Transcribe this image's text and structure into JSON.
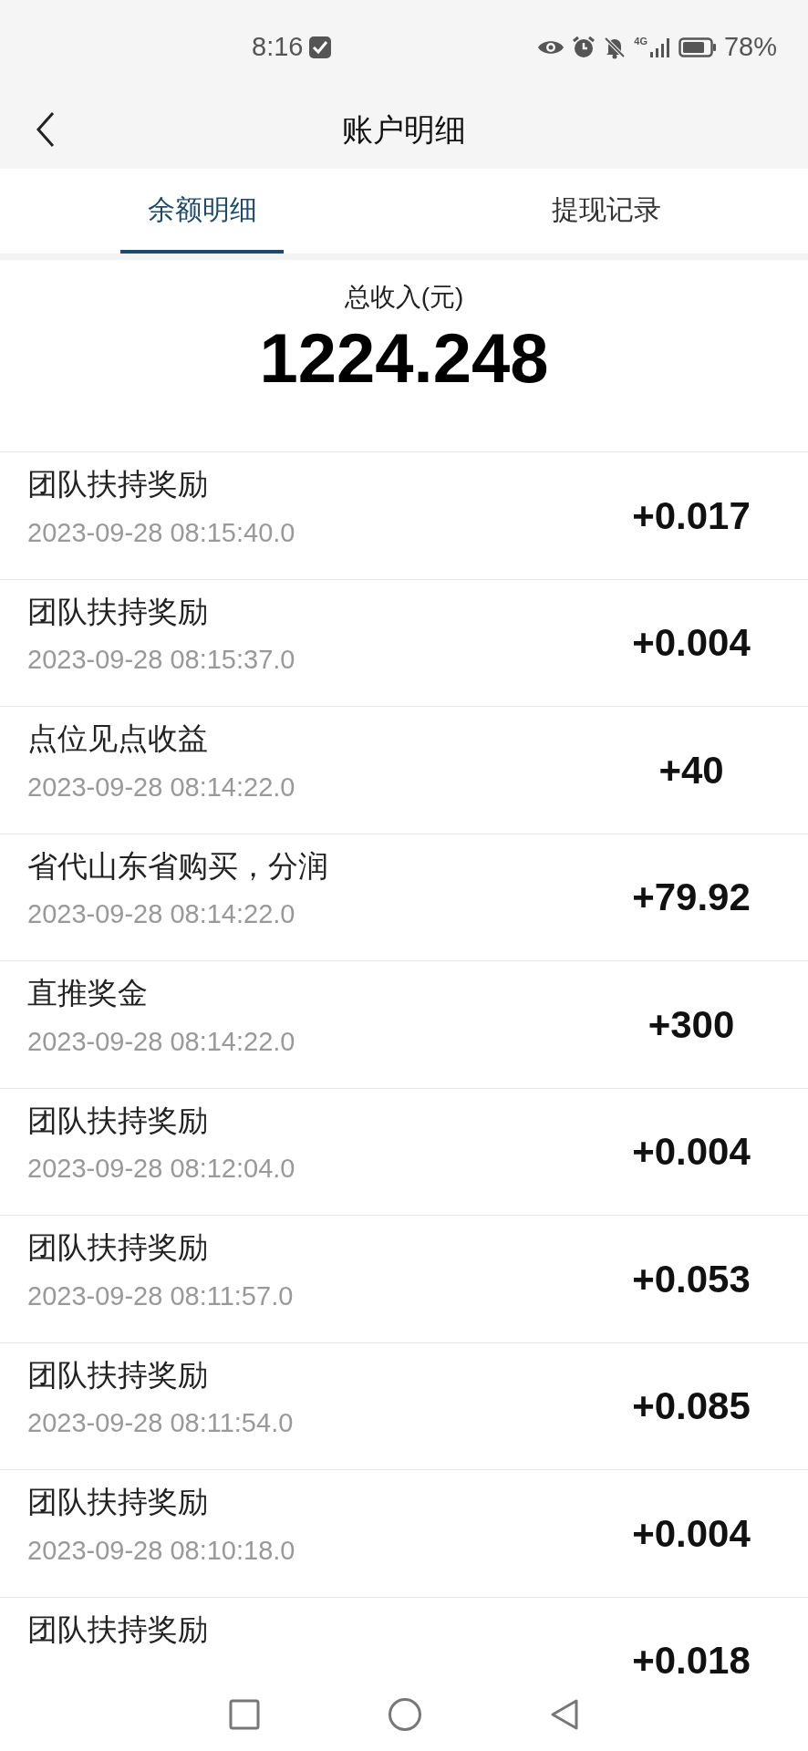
{
  "status_bar": {
    "time": "8:16",
    "network": "4G",
    "battery": "78%"
  },
  "header": {
    "title": "账户明细"
  },
  "tabs": [
    {
      "label": "余额明细",
      "selected": true
    },
    {
      "label": "提现记录",
      "selected": false
    }
  ],
  "summary": {
    "label": "总收入(元)",
    "total": "1224.248"
  },
  "records": [
    {
      "title": "团队扶持奖励",
      "time": "2023-09-28 08:15:40.0",
      "amount": "+0.017"
    },
    {
      "title": "团队扶持奖励",
      "time": "2023-09-28 08:15:37.0",
      "amount": "+0.004"
    },
    {
      "title": "点位见点收益",
      "time": "2023-09-28 08:14:22.0",
      "amount": "+40"
    },
    {
      "title": "省代山东省购买，分润",
      "time": "2023-09-28 08:14:22.0",
      "amount": "+79.92"
    },
    {
      "title": "直推奖金",
      "time": "2023-09-28 08:14:22.0",
      "amount": "+300"
    },
    {
      "title": "团队扶持奖励",
      "time": "2023-09-28 08:12:04.0",
      "amount": "+0.004"
    },
    {
      "title": "团队扶持奖励",
      "time": "2023-09-28 08:11:57.0",
      "amount": "+0.053"
    },
    {
      "title": "团队扶持奖励",
      "time": "2023-09-28 08:11:54.0",
      "amount": "+0.085"
    },
    {
      "title": "团队扶持奖励",
      "time": "2023-09-28 08:10:18.0",
      "amount": "+0.004"
    },
    {
      "title": "团队扶持奖励",
      "amount": "+0.018"
    }
  ]
}
